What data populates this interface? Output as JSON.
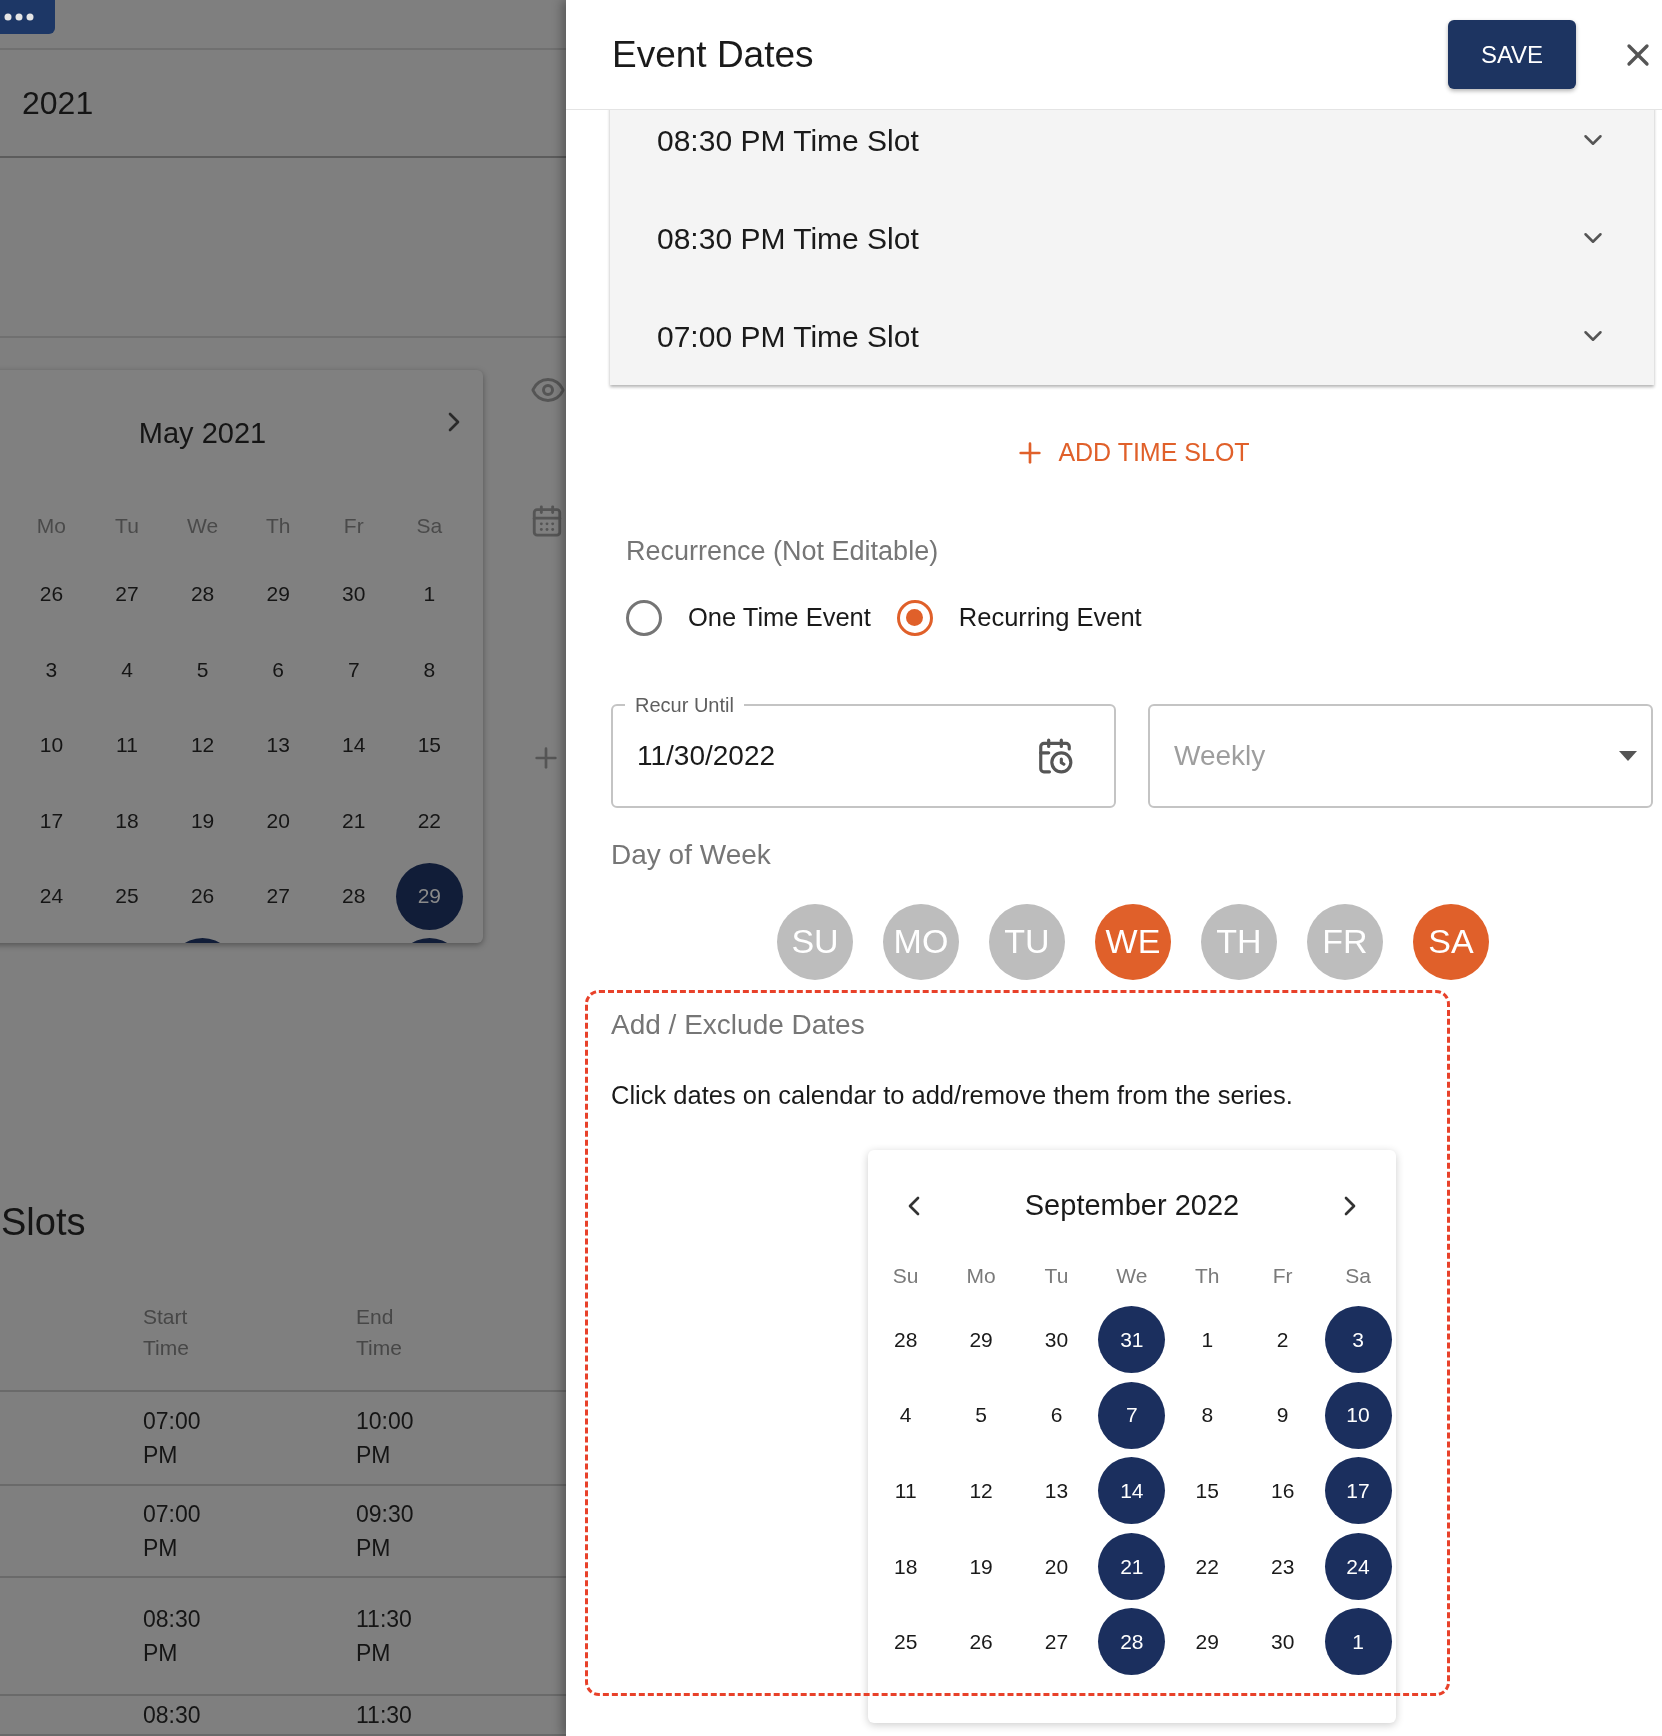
{
  "background_page": {
    "title": "2021",
    "calendar": {
      "month": "May 2021",
      "weekdays": [
        "Mo",
        "Tu",
        "We",
        "Th",
        "Fr",
        "Sa"
      ],
      "weeks": [
        [
          {
            "day": "26",
            "selected": false
          },
          {
            "day": "27",
            "selected": false
          },
          {
            "day": "28",
            "selected": false
          },
          {
            "day": "29",
            "selected": false
          },
          {
            "day": "30",
            "selected": false
          },
          {
            "day": "1",
            "selected": false
          }
        ],
        [
          {
            "day": "3",
            "selected": false
          },
          {
            "day": "4",
            "selected": false
          },
          {
            "day": "5",
            "selected": false
          },
          {
            "day": "6",
            "selected": false
          },
          {
            "day": "7",
            "selected": false
          },
          {
            "day": "8",
            "selected": false
          }
        ],
        [
          {
            "day": "10",
            "selected": false
          },
          {
            "day": "11",
            "selected": false
          },
          {
            "day": "12",
            "selected": false
          },
          {
            "day": "13",
            "selected": false
          },
          {
            "day": "14",
            "selected": false
          },
          {
            "day": "15",
            "selected": false
          }
        ],
        [
          {
            "day": "17",
            "selected": false
          },
          {
            "day": "18",
            "selected": false
          },
          {
            "day": "19",
            "selected": false
          },
          {
            "day": "20",
            "selected": false
          },
          {
            "day": "21",
            "selected": false
          },
          {
            "day": "22",
            "selected": false
          }
        ],
        [
          {
            "day": "24",
            "selected": false
          },
          {
            "day": "25",
            "selected": false
          },
          {
            "day": "26",
            "selected": false
          },
          {
            "day": "27",
            "selected": false
          },
          {
            "day": "28",
            "selected": false
          },
          {
            "day": "29",
            "selected": true
          }
        ],
        [
          {
            "selected": false
          },
          {
            "selected": false
          },
          {
            "selected": true
          },
          {
            "selected": false
          },
          {
            "selected": false
          },
          {
            "selected": true
          }
        ]
      ]
    },
    "section_title": "Slots",
    "table": {
      "columns": [
        "Start Time",
        "End Time"
      ],
      "rows": [
        [
          "07:00 PM",
          "10:00 PM"
        ],
        [
          "07:00 PM",
          "09:30 PM"
        ],
        [
          "08:30 PM",
          "11:30 PM"
        ],
        [
          "08:30",
          "11:30"
        ]
      ]
    }
  },
  "drawer": {
    "title": "Event Dates",
    "save": "SAVE",
    "time_slots": [
      {
        "label": "08:30 PM Time Slot",
        "expanded": false
      },
      {
        "label": "08:30 PM Time Slot",
        "expanded": false
      },
      {
        "label": "07:00 PM Time Slot",
        "expanded": false
      }
    ],
    "add_time_slot": "ADD TIME SLOT",
    "recurrence": {
      "label": "Recurrence (Not Editable)",
      "options": [
        {
          "label": "One Time Event",
          "selected": false
        },
        {
          "label": "Recurring Event",
          "selected": true
        }
      ]
    },
    "recur_until": {
      "label": "Recur Until",
      "value": "11/30/2022"
    },
    "frequency": {
      "value": "Weekly",
      "disabled": true
    },
    "day_of_week": {
      "label": "Day of Week",
      "days": [
        {
          "label": "SU",
          "selected": false
        },
        {
          "label": "MO",
          "selected": false
        },
        {
          "label": "TU",
          "selected": false
        },
        {
          "label": "WE",
          "selected": true
        },
        {
          "label": "TH",
          "selected": false
        },
        {
          "label": "FR",
          "selected": false
        },
        {
          "label": "SA",
          "selected": true
        }
      ]
    },
    "exclude_dates": {
      "label": "Add / Exclude Dates",
      "hint": "Click dates on calendar to add/remove them from the series.",
      "calendar": {
        "month": "September 2022",
        "weekdays": [
          "Su",
          "Mo",
          "Tu",
          "We",
          "Th",
          "Fr",
          "Sa"
        ],
        "weeks": [
          [
            {
              "day": "28",
              "selected": false
            },
            {
              "day": "29",
              "selected": false
            },
            {
              "day": "30",
              "selected": false
            },
            {
              "day": "31",
              "selected": true
            },
            {
              "day": "1",
              "selected": false
            },
            {
              "day": "2",
              "selected": false
            },
            {
              "day": "3",
              "selected": true
            }
          ],
          [
            {
              "day": "4",
              "selected": false
            },
            {
              "day": "5",
              "selected": false
            },
            {
              "day": "6",
              "selected": false
            },
            {
              "day": "7",
              "selected": true
            },
            {
              "day": "8",
              "selected": false
            },
            {
              "day": "9",
              "selected": false
            },
            {
              "day": "10",
              "selected": true
            }
          ],
          [
            {
              "day": "11",
              "selected": false
            },
            {
              "day": "12",
              "selected": false
            },
            {
              "day": "13",
              "selected": false
            },
            {
              "day": "14",
              "selected": true
            },
            {
              "day": "15",
              "selected": false
            },
            {
              "day": "16",
              "selected": false
            },
            {
              "day": "17",
              "selected": true
            }
          ],
          [
            {
              "day": "18",
              "selected": false
            },
            {
              "day": "19",
              "selected": false
            },
            {
              "day": "20",
              "selected": false
            },
            {
              "day": "21",
              "selected": true
            },
            {
              "day": "22",
              "selected": false
            },
            {
              "day": "23",
              "selected": false
            },
            {
              "day": "24",
              "selected": true
            }
          ],
          [
            {
              "day": "25",
              "selected": false
            },
            {
              "day": "26",
              "selected": false
            },
            {
              "day": "27",
              "selected": false
            },
            {
              "day": "28",
              "selected": true
            },
            {
              "day": "29",
              "selected": false
            },
            {
              "day": "30",
              "selected": false
            },
            {
              "day": "1",
              "selected": true
            }
          ]
        ]
      }
    }
  }
}
